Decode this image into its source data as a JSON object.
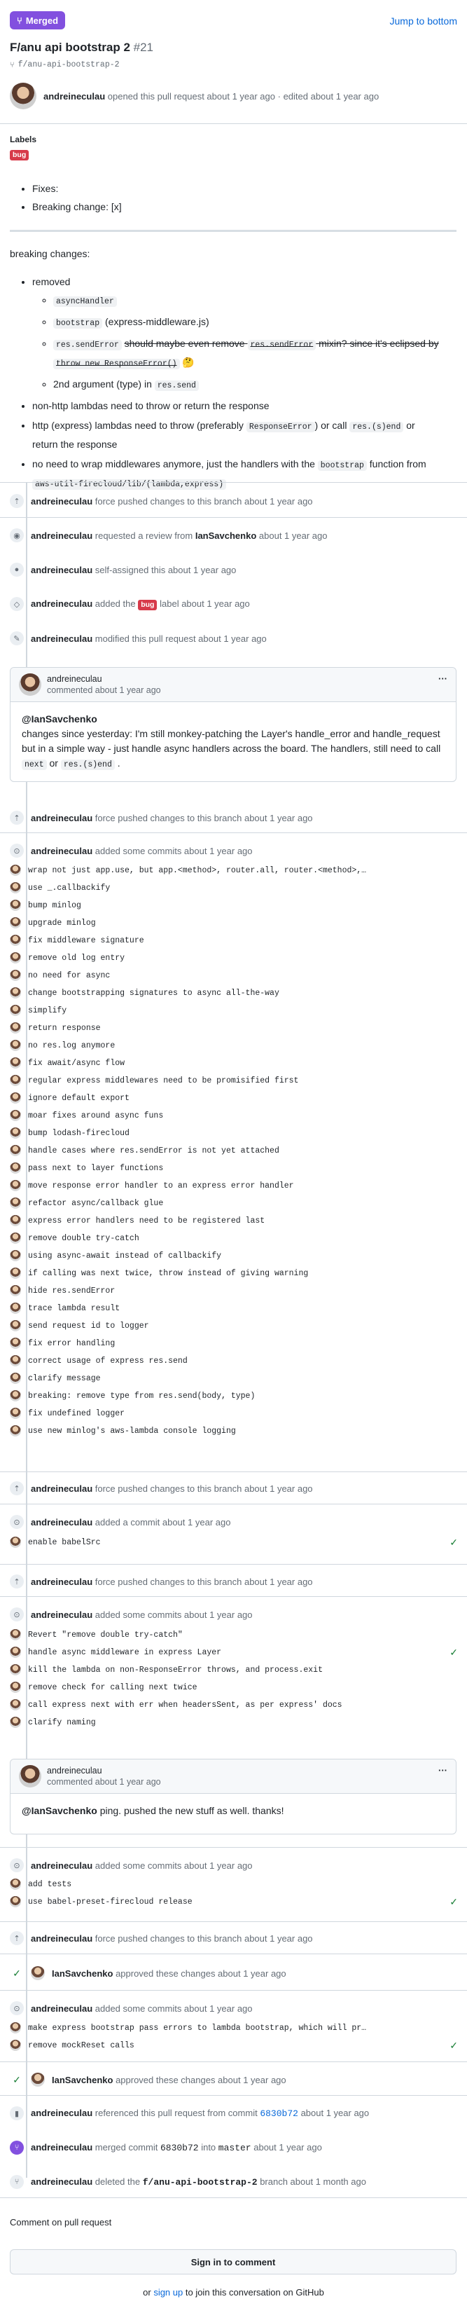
{
  "header": {
    "status": "Merged",
    "jump_link": "Jump to bottom",
    "title": "F/anu api bootstrap 2",
    "number": "#21",
    "branch": "f/anu-api-bootstrap-2",
    "author": "andreineculau",
    "opened_text": "opened this pull request about 1 year ago",
    "edited_text": "· edited about 1 year ago"
  },
  "labels": {
    "heading": "Labels",
    "items": [
      "bug"
    ]
  },
  "body": {
    "list1": [
      "Fixes:",
      "Breaking change: [x]"
    ],
    "section": "breaking changes:",
    "removed": "removed",
    "sub": {
      "code1": "asyncHandler",
      "code2": "bootstrap",
      "text2": "(express-middleware.js)",
      "code3": "res.sendError",
      "strike1": "should maybe even remove",
      "code3b": "res.sendError",
      "strike2": "mixin? since it's eclipsed by",
      "strike3": "throw new ResponseError()",
      "emoji": "🤔",
      "text4": "2nd argument (type) in",
      "code4": "res.send"
    },
    "b2": "non-http lambdas need to throw or return the response",
    "b3a": "http (express) lambdas need to throw (preferably",
    "b3code1": "ResponseError",
    "b3b": ") or call",
    "b3code2": "res.(s)end",
    "b3c": "or",
    "b3d": "return the response",
    "b4a": "no need to wrap middlewares anymore, just the handlers with the",
    "b4code": "bootstrap",
    "b4b": "function from",
    "b4code2": "aws-util-firecloud/lib/(lambda,express)"
  },
  "events": {
    "e1_user": "andreineculau",
    "e1_text": "force pushed changes to this branch about 1 year ago",
    "e2_user": "andreineculau",
    "e2_text": "requested a review from",
    "e2_target": "IanSavchenko",
    "e2_time": "about 1 year ago",
    "e3_user": "andreineculau",
    "e3_text": "self-assigned this about 1 year ago",
    "e4_user": "andreineculau",
    "e4_text": "added the",
    "e4_label": "bug",
    "e4_time": "label about 1 year ago",
    "e5_user": "andreineculau",
    "e5_text": "modified this pull request about 1 year ago",
    "e6_user": "andreineculau",
    "e6_text": "force pushed changes to this branch about 1 year ago",
    "e7_user": "andreineculau",
    "e7_text": "added some commits about 1 year ago",
    "e8_user": "andreineculau",
    "e8_text": "force pushed changes to this branch about 1 year ago",
    "e9_user": "andreineculau",
    "e9_text": "added a commit about 1 year ago",
    "e10_user": "andreineculau",
    "e10_text": "force pushed changes to this branch about 1 year ago",
    "e11_user": "andreineculau",
    "e11_text": "added some commits about 1 year ago",
    "e12_user": "andreineculau",
    "e12_text": "added some commits about 1 year ago",
    "e13_user": "andreineculau",
    "e13_text": "force pushed changes to this branch about 1 year ago",
    "e14_user": "IanSavchenko",
    "e14_text": "approved these changes about 1 year ago",
    "e15_user": "andreineculau",
    "e15_text": "added some commits about 1 year ago",
    "e16_user": "IanSavchenko",
    "e16_text": "approved these changes about 1 year ago",
    "e17_user": "andreineculau",
    "e17_text": "referenced this pull request from commit",
    "e17_sha": "6830b72",
    "e17_time": "about 1 year ago",
    "e18_user": "andreineculau",
    "e18_text": "merged commit",
    "e18_sha": "6830b72",
    "e18_into": "into",
    "e18_branch": "master",
    "e18_time": "about 1 year ago",
    "e19_user": "andreineculau",
    "e19_text": "deleted the",
    "e19_branch": "f/anu-api-bootstrap-2",
    "e19_time": "branch about 1 month ago"
  },
  "comment1": {
    "user": "andreineculau",
    "time": "commented about 1 year ago",
    "mention": "@IanSavchenko",
    "text": "changes since yesterday: I'm still monkey-patching the Layer's handle_error and handle_request but in a simple way - just handle async handlers across the board. The handlers, still need to call",
    "code1": "next",
    "or": "or",
    "code2": "res.(s)end",
    "end": "."
  },
  "comment2": {
    "user": "andreineculau",
    "time": "commented about 1 year ago",
    "mention": "@IanSavchenko",
    "text": "ping. pushed the new stuff as well. thanks!"
  },
  "commits1": [
    "wrap not just app.use, but app.<method>, router.all, router.<method>,…",
    "use _.callbackify",
    "bump minlog",
    "upgrade minlog",
    "fix middleware signature",
    "remove old log entry",
    "no need for async",
    "change bootstrapping signatures to async all-the-way",
    "simplify",
    "return response",
    "no res.log anymore",
    "fix await/async flow",
    "regular express middlewares need to be promisified first",
    "ignore default export",
    "moar fixes around async funs",
    "bump lodash-firecloud",
    "handle cases where res.sendError is not yet attached",
    "pass next to layer functions",
    "move response error handler to an express error handler",
    "refactor async/callback glue",
    "express error handlers need to be registered last",
    "remove double try-catch",
    "using async-await instead of callbackify",
    "if calling was next twice, throw instead of giving warning",
    "hide res.sendError",
    "trace lambda result",
    "send request id to logger",
    "fix error handling",
    "correct usage of express res.send",
    "clarify message",
    "breaking: remove type from res.send(body, type)",
    "fix undefined logger",
    "use new minlog's aws-lambda console logging"
  ],
  "commits2": [
    "enable babelSrc"
  ],
  "commits3": [
    "Revert \"remove double try-catch\"",
    "handle async middleware in express Layer",
    "kill the lambda on non-ResponseError throws, and process.exit",
    "remove check for calling next twice",
    "call express next with err when headersSent, as per express' docs",
    "clarify naming"
  ],
  "commits4": [
    "add tests",
    "use babel-preset-firecloud release"
  ],
  "commits5": [
    "make express bootstrap pass errors to lambda bootstrap, which will pr…",
    "remove mockReset calls"
  ],
  "footer": {
    "heading": "Comment on pull request",
    "signin_button": "Sign in to comment",
    "or_text": "or",
    "signup_link": "sign up",
    "join_text": "to join this conversation on GitHub"
  },
  "colors": {
    "merged": "#8250df",
    "link": "#0969da",
    "bug": "#d73a4a",
    "success": "#1a7f37"
  },
  "icons": [
    "merge-icon",
    "branch-icon",
    "push-icon",
    "eye-icon",
    "person-icon",
    "tag-icon",
    "pencil-icon",
    "commit-icon",
    "check-icon",
    "bookmark-icon",
    "kebab-icon"
  ]
}
